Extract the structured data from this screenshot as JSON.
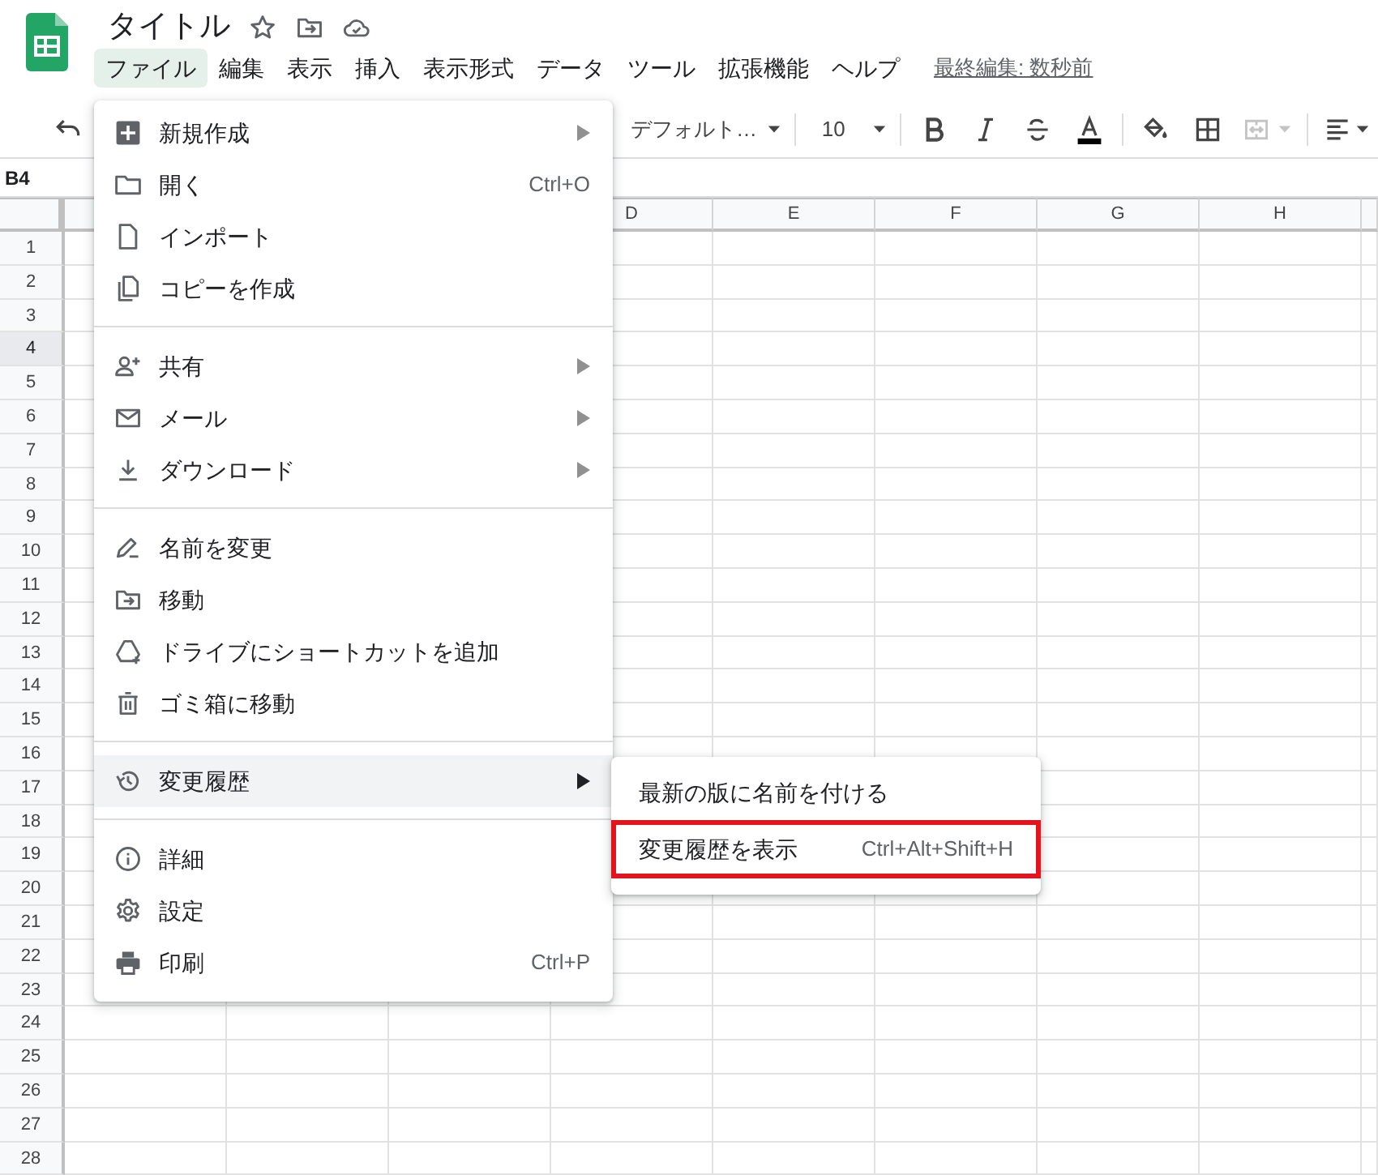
{
  "document": {
    "title": "タイトル"
  },
  "menubar": [
    {
      "label": "ファイル",
      "selected": true
    },
    {
      "label": "編集",
      "selected": false
    },
    {
      "label": "表示",
      "selected": false
    },
    {
      "label": "挿入",
      "selected": false
    },
    {
      "label": "表示形式",
      "selected": false
    },
    {
      "label": "データ",
      "selected": false
    },
    {
      "label": "ツール",
      "selected": false
    },
    {
      "label": "拡張機能",
      "selected": false
    },
    {
      "label": "ヘルプ",
      "selected": false
    }
  ],
  "last_edit": "最終編集: 数秒前",
  "toolbar": {
    "font": "デフォルト…",
    "font_size": "10",
    "merge_disabled": true
  },
  "name_box": "B4",
  "columns": [
    "D",
    "E",
    "F",
    "G",
    "H"
  ],
  "rows": [
    {
      "label": "1",
      "selected": false
    },
    {
      "label": "2",
      "selected": false
    },
    {
      "label": "3",
      "selected": false
    },
    {
      "label": "4",
      "selected": true
    },
    {
      "label": "5",
      "selected": false
    },
    {
      "label": "6",
      "selected": false
    },
    {
      "label": "7",
      "selected": false
    },
    {
      "label": "8",
      "selected": false
    },
    {
      "label": "9",
      "selected": false
    },
    {
      "label": "10",
      "selected": false
    },
    {
      "label": "11",
      "selected": false
    },
    {
      "label": "12",
      "selected": false
    },
    {
      "label": "13",
      "selected": false
    },
    {
      "label": "14",
      "selected": false
    },
    {
      "label": "15",
      "selected": false
    },
    {
      "label": "16",
      "selected": false
    },
    {
      "label": "17",
      "selected": false
    },
    {
      "label": "18",
      "selected": false
    },
    {
      "label": "19",
      "selected": false
    },
    {
      "label": "20",
      "selected": false
    },
    {
      "label": "21",
      "selected": false
    },
    {
      "label": "22",
      "selected": false
    },
    {
      "label": "23",
      "selected": false
    },
    {
      "label": "24",
      "selected": false
    },
    {
      "label": "25",
      "selected": false
    },
    {
      "label": "26",
      "selected": false
    },
    {
      "label": "27",
      "selected": false
    },
    {
      "label": "28",
      "selected": false
    }
  ],
  "file_menu": [
    {
      "kind": "item",
      "label": "新規作成",
      "submenu": true,
      "hovered": false
    },
    {
      "kind": "item",
      "label": "開く",
      "shortcut": "Ctrl+O",
      "submenu": false,
      "hovered": false
    },
    {
      "kind": "item",
      "label": "インポート",
      "submenu": false,
      "hovered": false
    },
    {
      "kind": "item",
      "label": "コピーを作成",
      "submenu": false,
      "hovered": false
    },
    {
      "kind": "separator"
    },
    {
      "kind": "item",
      "label": "共有",
      "submenu": true,
      "hovered": false
    },
    {
      "kind": "item",
      "label": "メール",
      "submenu": true,
      "hovered": false
    },
    {
      "kind": "item",
      "label": "ダウンロード",
      "submenu": true,
      "hovered": false
    },
    {
      "kind": "separator"
    },
    {
      "kind": "item",
      "label": "名前を変更",
      "submenu": false,
      "hovered": false
    },
    {
      "kind": "item",
      "label": "移動",
      "submenu": false,
      "hovered": false
    },
    {
      "kind": "item",
      "label": "ドライブにショートカットを追加",
      "submenu": false,
      "hovered": false
    },
    {
      "kind": "item",
      "label": "ゴミ箱に移動",
      "submenu": false,
      "hovered": false
    },
    {
      "kind": "separator"
    },
    {
      "kind": "item",
      "label": "変更履歴",
      "submenu": true,
      "hovered": true
    },
    {
      "kind": "separator"
    },
    {
      "kind": "item",
      "label": "詳細",
      "submenu": false,
      "hovered": false
    },
    {
      "kind": "item",
      "label": "設定",
      "submenu": false,
      "hovered": false
    },
    {
      "kind": "item",
      "label": "印刷",
      "shortcut": "Ctrl+P",
      "submenu": false,
      "hovered": false
    }
  ],
  "history_submenu": [
    {
      "label": "最新の版に名前を付ける",
      "outlined": false
    },
    {
      "label": "変更履歴を表示",
      "shortcut": "Ctrl+Alt+Shift+H",
      "outlined": true
    }
  ]
}
